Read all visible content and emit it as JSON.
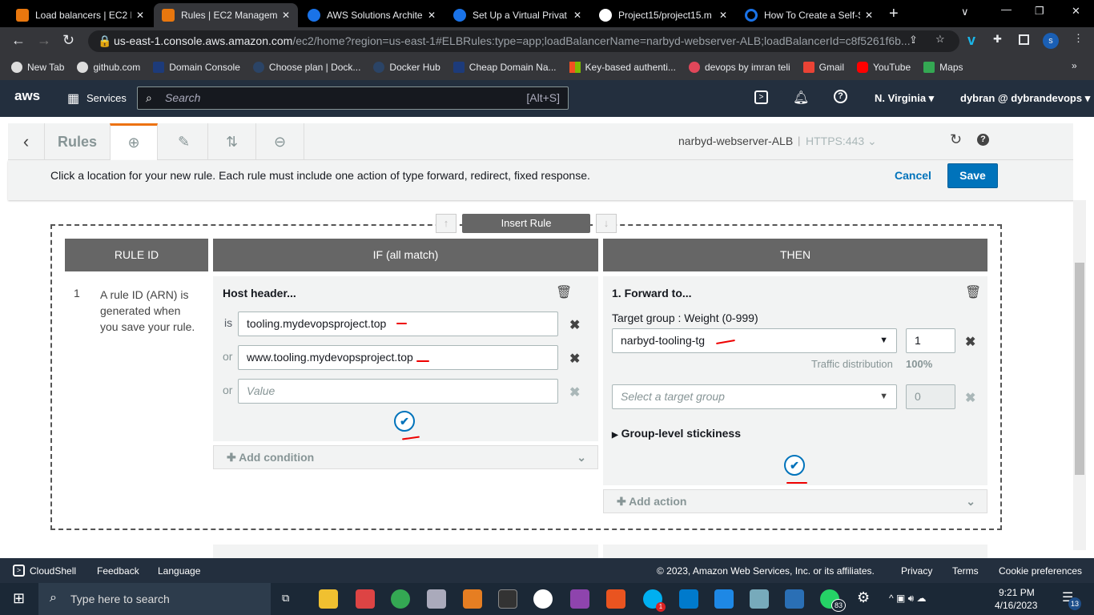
{
  "browser": {
    "tabs": [
      {
        "label": "Load balancers | EC2 M",
        "color": "#e8770e"
      },
      {
        "label": "Rules | EC2 Manageme",
        "color": "#e8770e",
        "active": true
      },
      {
        "label": "AWS Solutions Archite",
        "color": "#1a73e8"
      },
      {
        "label": "Set Up a Virtual Privat",
        "color": "#1a73e8"
      },
      {
        "label": "Project15/project15.m",
        "color": "#ffffff"
      },
      {
        "label": "How To Create a Self-S",
        "color": "#1a73e8"
      }
    ],
    "url_host": "us-east-1.console.aws.amazon.com",
    "url_path": "/ec2/home?region=us-east-1#ELBRules:type=app;loadBalancerName=narbyd-webserver-ALB;loadBalancerId=c8f5261f6b...",
    "profile_initial": "s",
    "bookmarks": [
      "New Tab",
      "github.com",
      "Domain Console",
      "Choose plan | Dock...",
      "Docker Hub",
      "Cheap Domain Na...",
      "Key-based authenti...",
      "devops by imran teli",
      "Gmail",
      "YouTube",
      "Maps"
    ]
  },
  "aws": {
    "logo": "aws",
    "services": "Services",
    "search_placeholder": "Search",
    "search_shortcut": "[Alt+S]",
    "region": "N. Virginia",
    "user": "dybran @ dybrandevops"
  },
  "toolbar": {
    "title": "Rules",
    "lb_name": "narbyd-webserver-ALB",
    "listener": "HTTPS:443"
  },
  "message": "Click a location for your new rule. Each rule must include one action of type forward, redirect, fixed response.",
  "cancel": "Cancel",
  "save": "Save",
  "insert_rule": "Insert Rule",
  "headers": {
    "rule_id": "RULE ID",
    "if": "IF (all match)",
    "then": "THEN"
  },
  "rule": {
    "id": "1",
    "id_text": "A rule ID (ARN) is generated when you save your rule."
  },
  "condition": {
    "title": "Host header...",
    "rows": [
      {
        "op": "is",
        "value": "tooling.mydevopsproject.top"
      },
      {
        "op": "or",
        "value": "www.tooling.mydevopsproject.top"
      },
      {
        "op": "or",
        "placeholder": "Value"
      }
    ],
    "add": "Add condition"
  },
  "action": {
    "title": "1. Forward to...",
    "tg_label": "Target group : Weight (0-999)",
    "tg1": "narbyd-tooling-tg",
    "w1": "1",
    "dist_label": "Traffic distribution",
    "dist_value": "100%",
    "tg2_placeholder": "Select a target group",
    "w2": "0",
    "stickiness": "Group-level stickiness",
    "add": "Add action"
  },
  "footer": {
    "cloudshell": "CloudShell",
    "feedback": "Feedback",
    "language": "Language",
    "copyright": "© 2023, Amazon Web Services, Inc. or its affiliates.",
    "privacy": "Privacy",
    "terms": "Terms",
    "cookies": "Cookie preferences"
  },
  "taskbar": {
    "search": "Type here to search",
    "time": "9:21 PM",
    "date": "4/16/2023",
    "notifications": "13",
    "whatsapp_badge": "83",
    "skype_badge": "1"
  }
}
